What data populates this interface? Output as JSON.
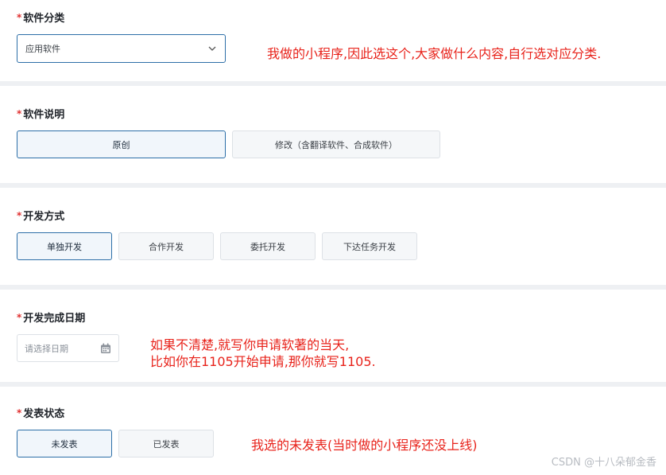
{
  "required_mark": "*",
  "sections": {
    "category": {
      "label": "软件分类",
      "select_value": "应用软件",
      "note": "我做的小程序,因此选这个,大家做什么内容,自行选对应分类."
    },
    "description": {
      "label": "软件说明",
      "options": [
        "原创",
        "修改（含翻译软件、合成软件）"
      ],
      "selected": "原创"
    },
    "dev_mode": {
      "label": "开发方式",
      "options": [
        "单独开发",
        "合作开发",
        "委托开发",
        "下达任务开发"
      ],
      "selected": "单独开发"
    },
    "complete_date": {
      "label": "开发完成日期",
      "placeholder": "请选择日期",
      "note_line1": "如果不清楚,就写你申请软著的当天,",
      "note_line2": "比如你在1105开始申请,那你就写1105."
    },
    "publish_status": {
      "label": "发表状态",
      "options": [
        "未发表",
        "已发表"
      ],
      "selected": "未发表",
      "note": "我选的未发表(当时做的小程序还没上线)"
    }
  },
  "watermark": "CSDN @十八朵郁金香",
  "icons": {
    "select": "chevron-down-icon",
    "date": "calendar-icon"
  },
  "colors": {
    "accent": "#2d6fa8",
    "required": "#e02f2f",
    "note": "#e8231b",
    "divider": "#eef0f3"
  }
}
